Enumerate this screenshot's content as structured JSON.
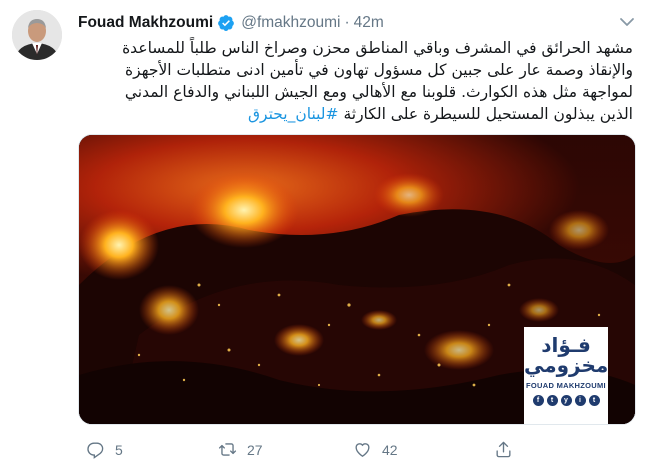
{
  "tweet": {
    "author_name": "Fouad Makhzoumi",
    "handle": "@fmakhzoumi",
    "separator": "·",
    "time": "42m",
    "text_lines": [
      "مشهد الحرائق في المشرف وباقي المناطق محزن وصراخ الناس طلباً للمساعدة",
      "والإنقاذ وصمة عار على جبين كل مسؤول تهاون في تأمين ادنى متطلبات الأجهزة",
      "لمواجهة مثل هذه الكوارث. قلوبنا مع الأهالي ومع الجيش اللبناني والدفاع المدني",
      "الذين يبذلون المستحيل للسيطرة على الكارثة"
    ],
    "hashtag": "#لبنان_يحترق",
    "media_logo": {
      "arabic_line1": "فـؤاد",
      "arabic_line2": "مخزومي",
      "english": "FOUAD MAKHZOUMI",
      "socials": [
        "f",
        "t",
        "y",
        "i",
        "t"
      ]
    },
    "actions": {
      "reply_count": "5",
      "retweet_count": "27",
      "like_count": "42"
    }
  },
  "colors": {
    "link": "#1b95e0",
    "verified": "#1da1f2",
    "muted": "#657786",
    "logo_blue": "#1f3b6e"
  },
  "icons": [
    "avatar-photo",
    "verified-badge-icon",
    "chevron-down-icon",
    "reply-icon",
    "retweet-icon",
    "like-icon",
    "share-icon"
  ]
}
